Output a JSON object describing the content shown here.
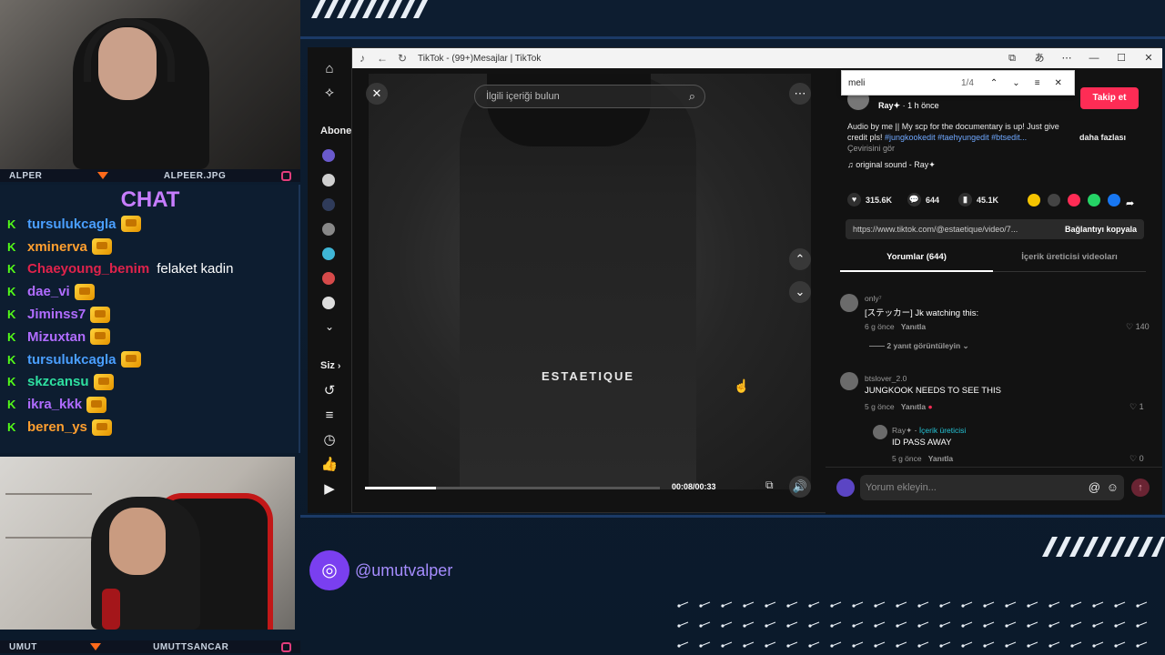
{
  "overlay": {
    "cam_top": {
      "left": "ALPER",
      "right": "ALPEER.JPG"
    },
    "cam_bottom": {
      "left": "UMUT",
      "right": "UMUTTSANCAR"
    },
    "chat_title": "CHAT",
    "chat": [
      {
        "user": "tursulukcagla",
        "color": "#4a9fff",
        "badge": true,
        "msg": ""
      },
      {
        "user": "xminerva",
        "color": "#ff9f2f",
        "badge": true,
        "msg": ""
      },
      {
        "user": "Chaeyoung_benim",
        "color": "#e0234b",
        "badge": false,
        "msg": "felaket kadin"
      },
      {
        "user": "dae_vi",
        "color": "#b06cff",
        "badge": true,
        "msg": ""
      },
      {
        "user": "Jiminss7",
        "color": "#b06cff",
        "badge": true,
        "msg": ""
      },
      {
        "user": "Mizuxtan",
        "color": "#b06cff",
        "badge": true,
        "msg": ""
      },
      {
        "user": "tursulukcagla",
        "color": "#4a9fff",
        "badge": true,
        "msg": ""
      },
      {
        "user": "skzcansu",
        "color": "#2fe0a0",
        "badge": true,
        "msg": ""
      },
      {
        "user": "ikra_kkk",
        "color": "#b06cff",
        "badge": true,
        "msg": ""
      },
      {
        "user": "beren_ys",
        "color": "#ff9f2f",
        "badge": true,
        "msg": ""
      }
    ],
    "handle": "@umutvalper"
  },
  "browser": {
    "title": "TikTok - (99+)Mesajlar | TikTok",
    "find": {
      "query": "meli",
      "count": "1/4"
    }
  },
  "tiktok_nav": {
    "subscriptions_label": "Abonel",
    "you_label": "Siz"
  },
  "video": {
    "search_placeholder": "İlgili içeriği bulun",
    "watermark": "ESTAETIQUE",
    "time": "00:08/00:33",
    "progress": 0.24
  },
  "post": {
    "author": "Ray✦",
    "time_ago": "1 h önce",
    "follow_label": "Takip et",
    "caption": "Audio by me || My scp for the documentary is up! Just give credit pls!",
    "tags": "#jungkookedit #taehyungedit #btsedit...",
    "more_label": "daha fazlası",
    "translate_label": "Çevirisini gör",
    "sound": "original sound - Ray✦",
    "likes": "315.6K",
    "comments": "644",
    "saves": "45.1K",
    "link": "https://www.tiktok.com/@estaetique/video/7...",
    "copy_label": "Bağlantıyı kopyala",
    "tab_comments": "Yorumlar (644)",
    "tab_creator": "İçerik üreticisi videoları"
  },
  "comments": [
    {
      "user": "only⁷",
      "text": "[ステッカー] Jk watching this:",
      "time": "6 g önce",
      "reply": "Yanıtla",
      "likes": "140",
      "view_replies": "2 yanıt görüntüleyin"
    },
    {
      "user": "btslover_2.0",
      "text": "JUNGKOOK NEEDS TO SEE THIS",
      "time": "5 g önce",
      "reply": "Yanıtla",
      "likes": "1"
    },
    {
      "user": "Ray✦",
      "creator_tag": "İçerik üreticisi",
      "text": "ID PASS AWAY",
      "time": "5 g önce",
      "reply": "Yanıtla",
      "likes": "0"
    }
  ],
  "comment_input_placeholder": "Yorum ekleyin..."
}
